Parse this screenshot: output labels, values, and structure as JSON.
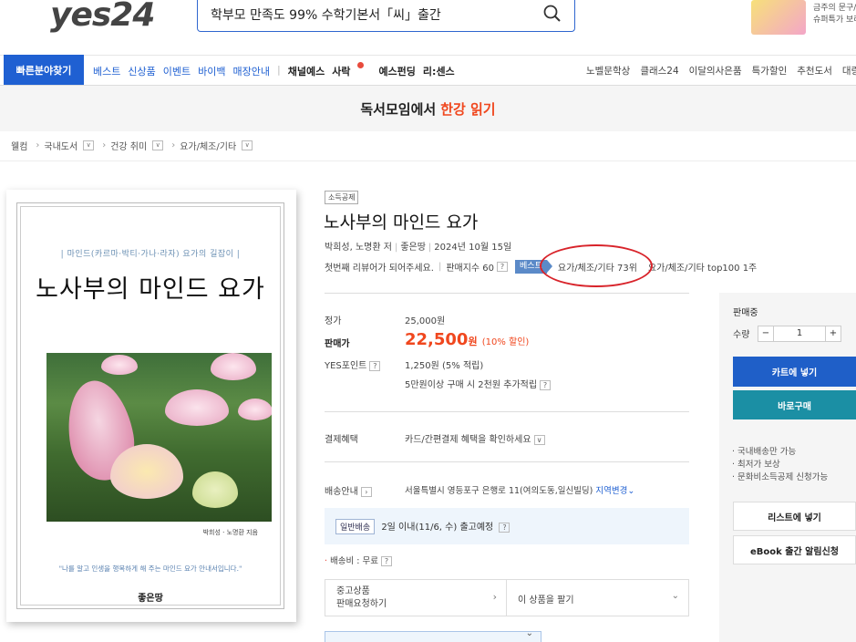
{
  "header": {
    "logo": "yes24",
    "search_value": "학부모 만족도 99% 수학기본서「씨」출간",
    "promo_line1": "금주의 문구/",
    "promo_line2": "슈퍼특가 보러"
  },
  "nav": {
    "quick": "빠른분야찾기",
    "left_blue": [
      "베스트",
      "신상품",
      "이벤트",
      "바이백",
      "매장안내"
    ],
    "left_dark": [
      "채널예스",
      "사락",
      "예스펀딩",
      "리:센스"
    ],
    "right": [
      "노벨문학상",
      "클래스24",
      "이달의사은품",
      "특가할인",
      "추천도서",
      "대량"
    ]
  },
  "banner": {
    "text": "독서모임에서",
    "highlight": "한강 읽기"
  },
  "breadcrumb": [
    "웰컴",
    "국내도서",
    "건강 취미",
    "요가/체조/기타"
  ],
  "cover": {
    "subtitle": "| 마인드(카르마·박티·가나·라자) 요가의 길잡이 |",
    "title": "노사부의 마인드 요가",
    "author": "박희성 · 노명환 지음",
    "quote": "\"나를 알고 인생을 행복하게 해 주는 마인드 요가 안내서입니다.\"",
    "publisher": "좋은땅"
  },
  "product": {
    "tag": "소득공제",
    "title": "노사부의 마인드 요가",
    "authors": "박희성, 노명환 저",
    "publisher": "좋은땅",
    "date": "2024년 10월 15일",
    "review": "첫번째 리뷰어가 되어주세요.",
    "sales_index": "판매지수 60",
    "best_badge": "베스트",
    "rank1": "요가/체조/기타 73위",
    "rank2": "요가/체조/기타 top100 1주"
  },
  "price": {
    "list_label": "정가",
    "list_value": "25,000원",
    "sale_label": "판매가",
    "sale_value": "22,500",
    "sale_unit": "원",
    "discount": "(10% 할인)",
    "points_label": "YES포인트",
    "points_value": "1,250원 (5% 적립)",
    "points_extra": "5만원이상 구매 시 2천원 추가적립"
  },
  "benefit": {
    "label": "결제혜택",
    "value": "카드/간편결제 혜택을 확인하세요"
  },
  "shipping": {
    "label": "배송안내",
    "address": "서울특별시 영등포구 은행로 11(여의도동,일신빌딩)",
    "change": "지역변경",
    "chip": "일반배송",
    "eta": "2일 이내(11/6, 수) 출고예정",
    "fee": "배송비 : 무료"
  },
  "used": {
    "left_line1": "중고상품",
    "left_line2": "판매요청하기",
    "right": "이 상품을 팔기"
  },
  "rpanel": {
    "status": "판매중",
    "qty_label": "수량",
    "qty": "1",
    "cart": "카트에 넣기",
    "buy": "바로구매",
    "info": [
      "· 국내배송만 가능",
      "· 최저가 보상",
      "· 문화비소득공제 신청가능"
    ],
    "wishlist": "리스트에 넣기",
    "ebook": "eBook 출간 알림신청"
  }
}
